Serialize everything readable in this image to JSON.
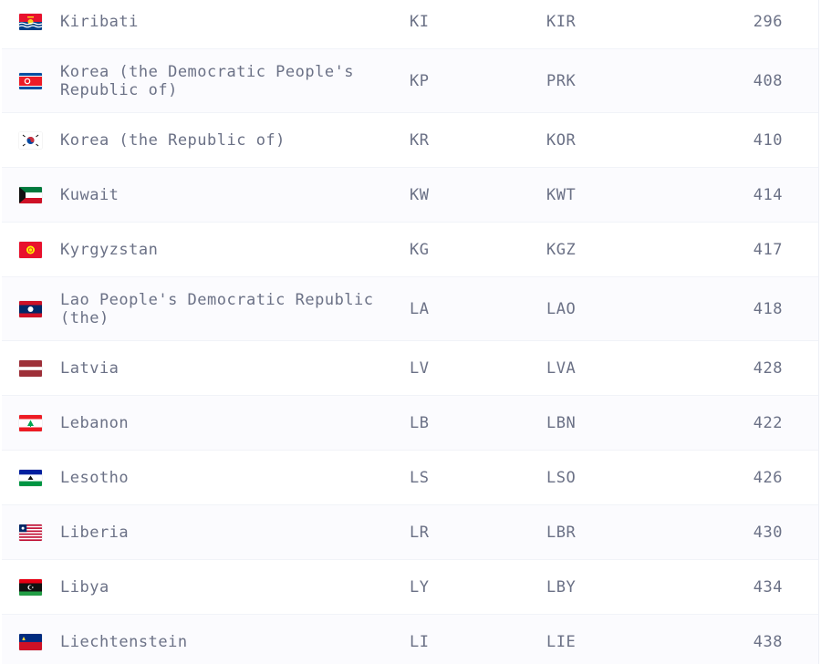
{
  "countries": [
    {
      "name": "Kiribati",
      "alpha2": "KI",
      "alpha3": "KIR",
      "numeric": "296",
      "flag": "flag-kiribati-icon"
    },
    {
      "name": "Korea (the Democratic People's Republic of)",
      "alpha2": "KP",
      "alpha3": "PRK",
      "numeric": "408",
      "flag": "flag-north-korea-icon"
    },
    {
      "name": "Korea (the Republic of)",
      "alpha2": "KR",
      "alpha3": "KOR",
      "numeric": "410",
      "flag": "flag-south-korea-icon"
    },
    {
      "name": "Kuwait",
      "alpha2": "KW",
      "alpha3": "KWT",
      "numeric": "414",
      "flag": "flag-kuwait-icon"
    },
    {
      "name": "Kyrgyzstan",
      "alpha2": "KG",
      "alpha3": "KGZ",
      "numeric": "417",
      "flag": "flag-kyrgyzstan-icon"
    },
    {
      "name": "Lao People's Democratic Republic (the)",
      "alpha2": "LA",
      "alpha3": "LAO",
      "numeric": "418",
      "flag": "flag-laos-icon"
    },
    {
      "name": "Latvia",
      "alpha2": "LV",
      "alpha3": "LVA",
      "numeric": "428",
      "flag": "flag-latvia-icon"
    },
    {
      "name": "Lebanon",
      "alpha2": "LB",
      "alpha3": "LBN",
      "numeric": "422",
      "flag": "flag-lebanon-icon"
    },
    {
      "name": "Lesotho",
      "alpha2": "LS",
      "alpha3": "LSO",
      "numeric": "426",
      "flag": "flag-lesotho-icon"
    },
    {
      "name": "Liberia",
      "alpha2": "LR",
      "alpha3": "LBR",
      "numeric": "430",
      "flag": "flag-liberia-icon"
    },
    {
      "name": "Libya",
      "alpha2": "LY",
      "alpha3": "LBY",
      "numeric": "434",
      "flag": "flag-libya-icon"
    },
    {
      "name": "Liechtenstein",
      "alpha2": "LI",
      "alpha3": "LIE",
      "numeric": "438",
      "flag": "flag-liechtenstein-icon"
    }
  ],
  "colors": {
    "text": "#6b7186",
    "row_alt": "#fbfbfe",
    "divider": "#f1f3f8"
  }
}
